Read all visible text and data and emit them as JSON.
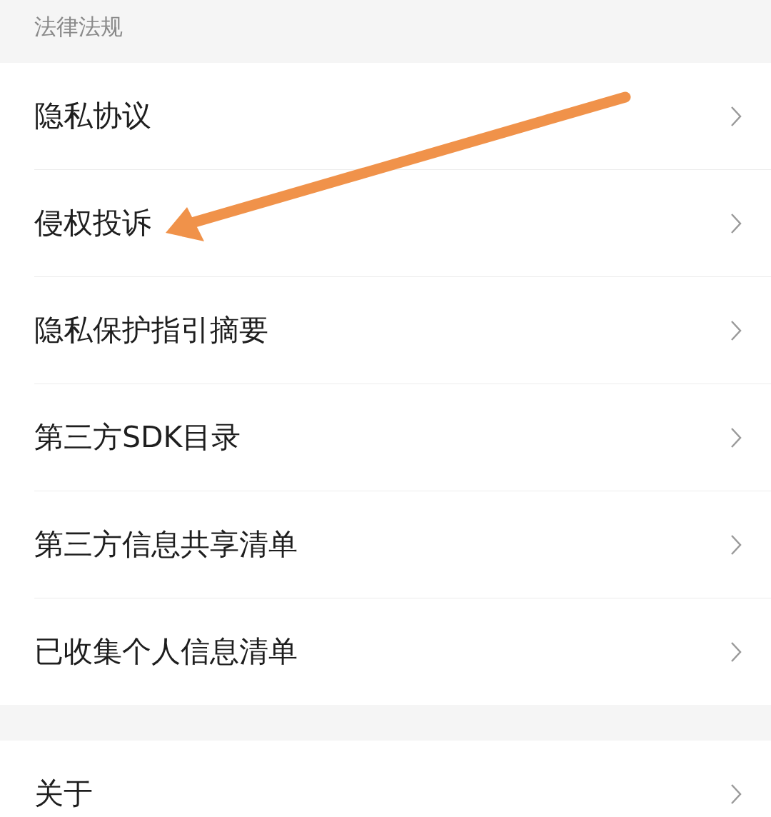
{
  "section_title": "法律法规",
  "items": [
    {
      "label": "隐私协议"
    },
    {
      "label": "侵权投诉"
    },
    {
      "label": "隐私保护指引摘要"
    },
    {
      "label": "第三方SDK目录"
    },
    {
      "label": "第三方信息共享清单"
    },
    {
      "label": "已收集个人信息清单"
    }
  ],
  "more_items": [
    {
      "label": "关于"
    }
  ]
}
